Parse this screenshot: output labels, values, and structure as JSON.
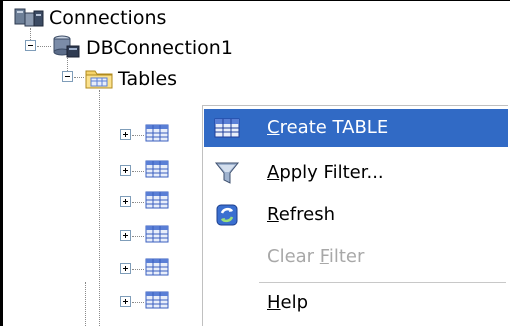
{
  "tree": {
    "root_label": "Connections",
    "connection_label": "DBConnection1",
    "tables_label": "Tables",
    "table_nodes": 6
  },
  "context_menu": {
    "items": [
      {
        "pre": "",
        "mnemonic": "C",
        "post": "reate TABLE",
        "icon": "create-table-icon",
        "highlighted": true,
        "enabled": true
      },
      {
        "pre": "",
        "mnemonic": "A",
        "post": "pply Filter...",
        "icon": "filter-funnel-icon",
        "highlighted": false,
        "enabled": true
      },
      {
        "pre": "",
        "mnemonic": "R",
        "post": "efresh",
        "icon": "refresh-icon",
        "highlighted": false,
        "enabled": true
      },
      {
        "pre": "Clear ",
        "mnemonic": "F",
        "post": "ilter",
        "icon": "",
        "highlighted": false,
        "enabled": false
      },
      {
        "pre": "",
        "mnemonic": "H",
        "post": "elp",
        "icon": "",
        "highlighted": false,
        "enabled": true
      }
    ]
  },
  "colors": {
    "highlight": "#316ac5",
    "disabled_text": "#a8a8a8",
    "folder": "#f5d36b",
    "table_grid": "#5a7fd6"
  }
}
